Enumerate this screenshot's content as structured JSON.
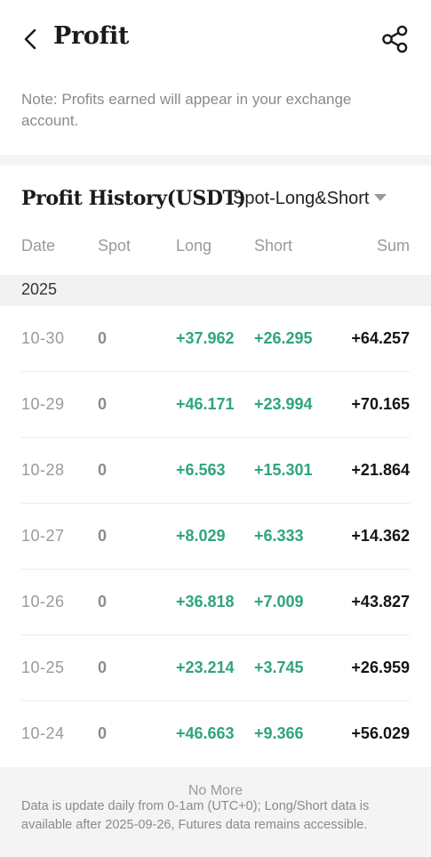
{
  "header": {
    "title": "Profit",
    "back_icon": "chevron-left-icon",
    "share_icon": "share-icon"
  },
  "note": "Note: Profits earned will appear in your exchange account.",
  "history": {
    "title": "Profit History(USDT)",
    "filter_label": "Spot-Long&Short",
    "columns": {
      "date": "Date",
      "spot": "Spot",
      "long": "Long",
      "short": "Short",
      "sum": "Sum"
    },
    "year": "2025",
    "rows": [
      {
        "date": "10-30",
        "spot": "0",
        "long": "+37.962",
        "short": "+26.295",
        "sum": "+64.257"
      },
      {
        "date": "10-29",
        "spot": "0",
        "long": "+46.171",
        "short": "+23.994",
        "sum": "+70.165"
      },
      {
        "date": "10-28",
        "spot": "0",
        "long": "+6.563",
        "short": "+15.301",
        "sum": "+21.864"
      },
      {
        "date": "10-27",
        "spot": "0",
        "long": "+8.029",
        "short": "+6.333",
        "sum": "+14.362"
      },
      {
        "date": "10-26",
        "spot": "0",
        "long": "+36.818",
        "short": "+7.009",
        "sum": "+43.827"
      },
      {
        "date": "10-25",
        "spot": "0",
        "long": "+23.214",
        "short": "+3.745",
        "sum": "+26.959"
      },
      {
        "date": "10-24",
        "spot": "0",
        "long": "+46.663",
        "short": "+9.366",
        "sum": "+56.029"
      }
    ]
  },
  "footer": {
    "no_more": "No More",
    "note": "Data is update daily from 0-1am (UTC+0); Long/Short data is available after 2025-09-26, Futures data remains accessible."
  },
  "colors": {
    "positive": "#2fa57a",
    "muted": "#9a9a9a",
    "band": "#f4f4f4"
  }
}
